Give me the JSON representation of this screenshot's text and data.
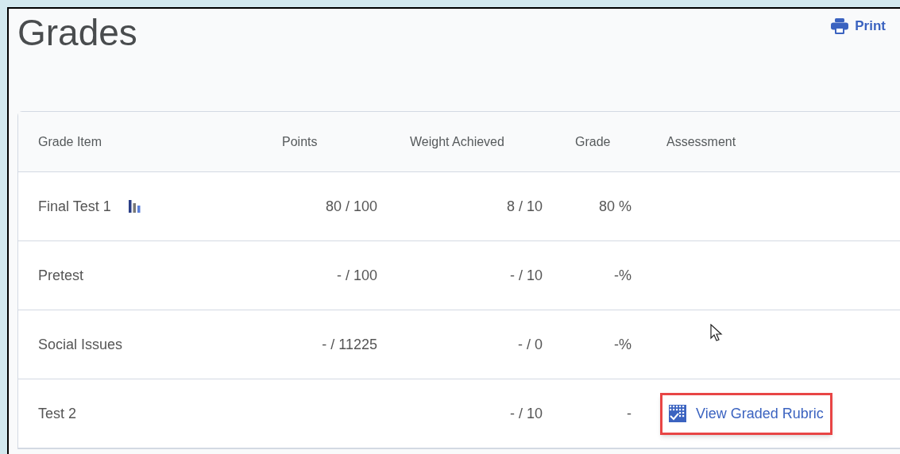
{
  "page": {
    "title": "Grades"
  },
  "print": {
    "label": "Print"
  },
  "table": {
    "columns": [
      "Grade Item",
      "Points",
      "Weight Achieved",
      "Grade",
      "Assessment"
    ],
    "rows": [
      {
        "item": "Final Test 1",
        "statistics_icon": true,
        "points": "80 / 100",
        "weight": "8 / 10",
        "grade": "80 %"
      },
      {
        "item": "Pretest",
        "statistics_icon": false,
        "points": "- / 100",
        "weight": "- / 10",
        "grade": "-%"
      },
      {
        "item": "Social Issues",
        "statistics_icon": false,
        "points": "- / 11225",
        "weight": "- / 0",
        "grade": "-%"
      },
      {
        "item": "Test 2",
        "statistics_icon": false,
        "weight": "- / 10",
        "grade": "-",
        "assessment": {
          "label": "View Graded Rubric",
          "highlighted": true
        }
      }
    ]
  }
}
